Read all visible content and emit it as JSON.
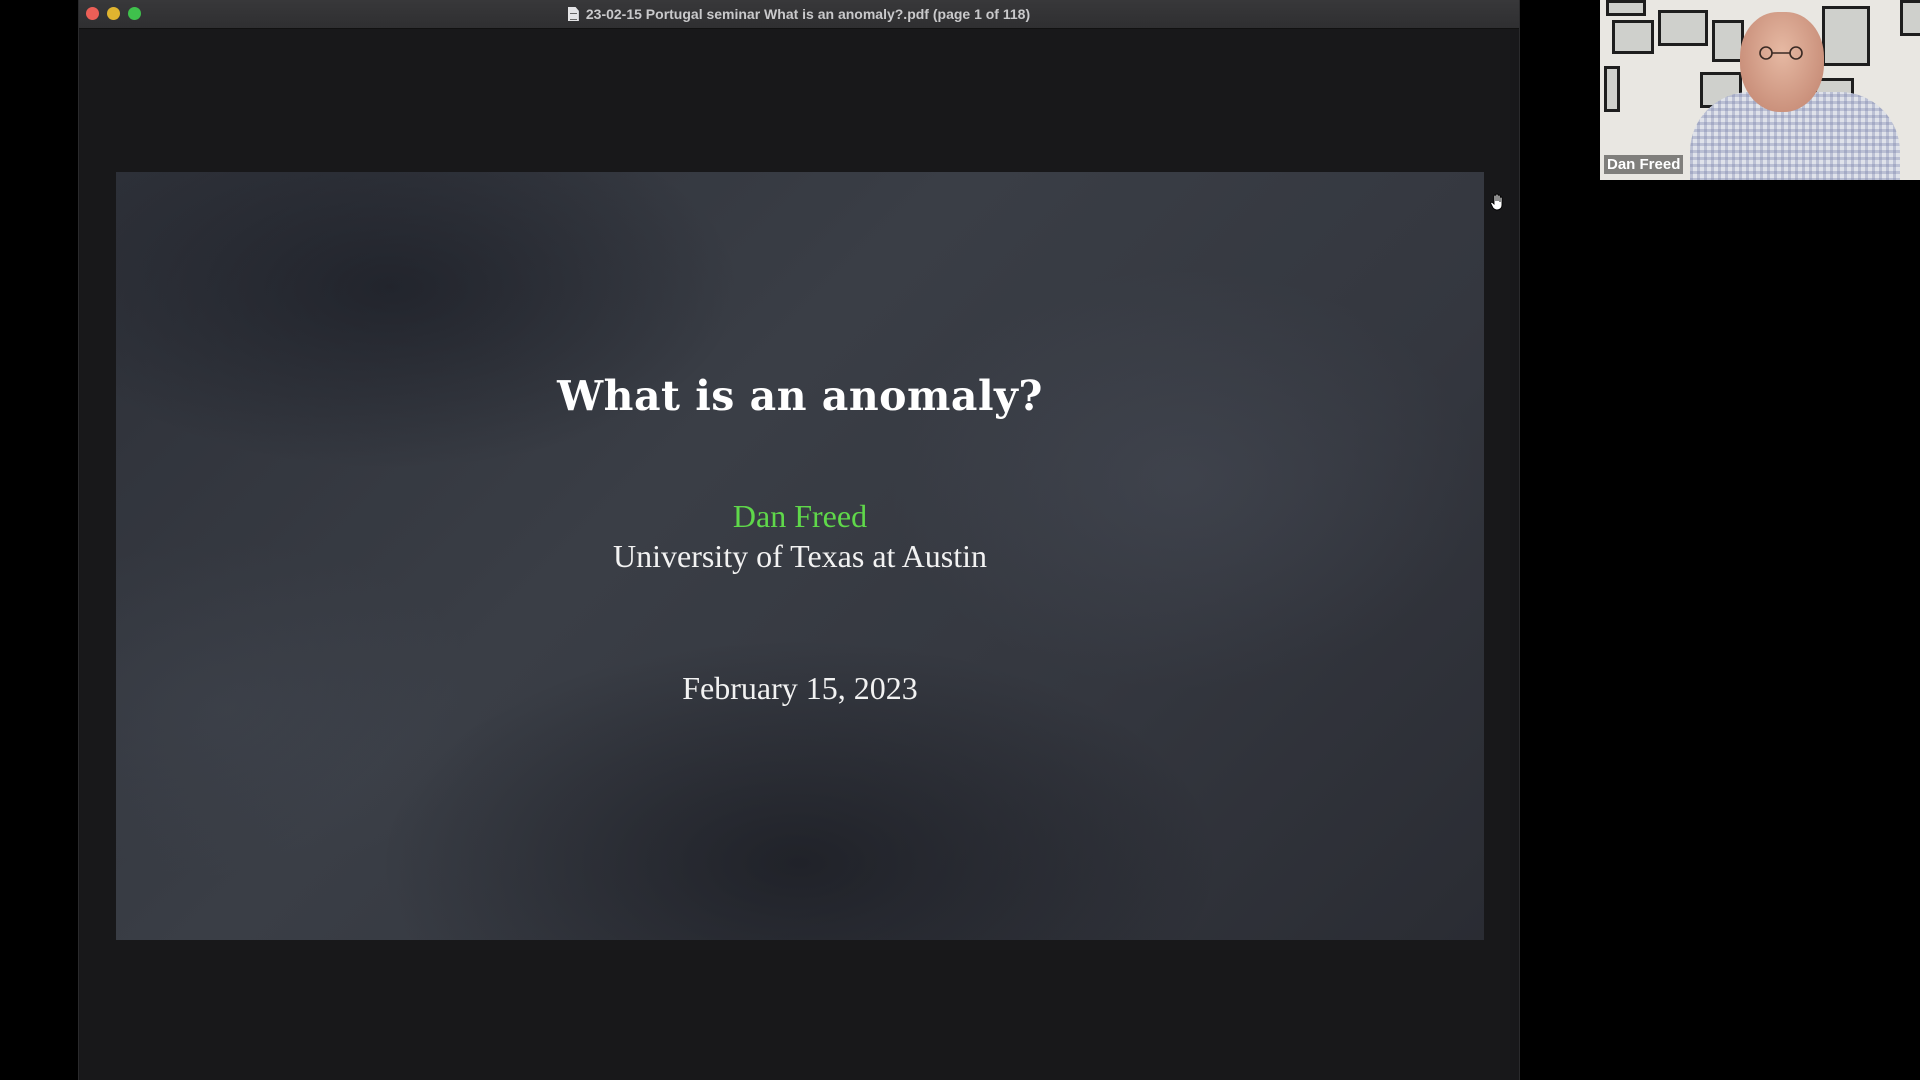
{
  "window": {
    "title": "23-02-15 Portugal seminar What is an anomaly?.pdf (page 1 of 118)"
  },
  "slide": {
    "title": "What is an anomaly?",
    "author": "Dan Freed",
    "affiliation": "University of Texas at Austin",
    "date": "February 15, 2023",
    "author_color": "#5fd84a"
  },
  "video": {
    "participant_name": "Dan Freed"
  },
  "icons": {
    "document": "pdf-document-icon",
    "cursor": "hand-cursor-icon"
  }
}
